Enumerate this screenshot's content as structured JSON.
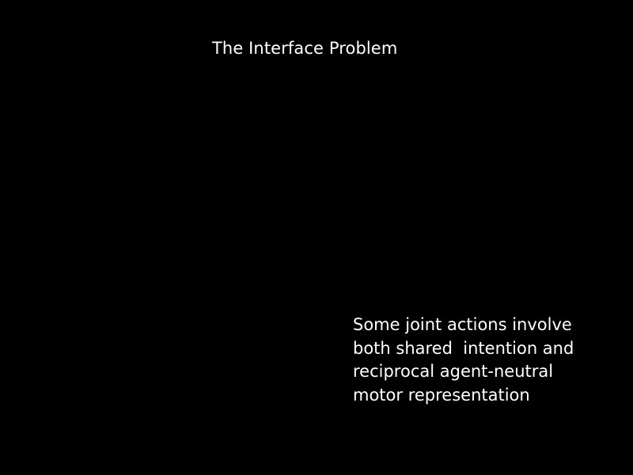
{
  "slide": {
    "title": "The Interface Problem",
    "body_lines": [
      "Some joint actions involve",
      "both shared  intention and",
      "reciprocal agent-neutral",
      "motor representation"
    ]
  },
  "colors": {
    "background": "#000000",
    "text": "#ffffff"
  }
}
